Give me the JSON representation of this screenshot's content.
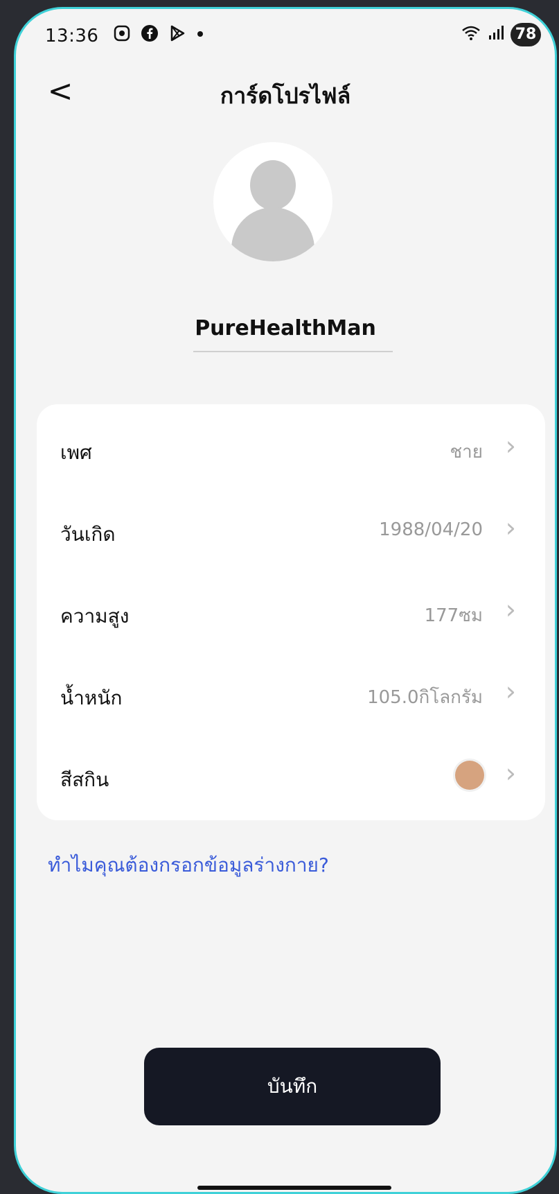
{
  "status": {
    "time": "13:36",
    "battery": "78",
    "icons_left": [
      "screen-record-icon",
      "facebook-icon",
      "play-store-icon",
      "dot-icon"
    ],
    "icons_right": [
      "wifi-icon",
      "signal-icon",
      "battery-icon"
    ]
  },
  "header": {
    "back": "<",
    "title": "การ์ดโปรไฟล์"
  },
  "profile": {
    "username": "PureHealthMan"
  },
  "fields": [
    {
      "label": "เพศ",
      "value": "ชาย"
    },
    {
      "label": "วันเกิด",
      "value": "1988/04/20"
    },
    {
      "label": "ความสูง",
      "value": "177ซม"
    },
    {
      "label": "น้ำหนัก",
      "value": "105.0กิโลกรัม"
    },
    {
      "label": "สีสกิน",
      "value": "",
      "swatch_color": "#d6a37f"
    }
  ],
  "why_link": "ทำไมคุณต้องกรอกข้อมูลร่างกาย?",
  "save_button": "บันทึก",
  "colors": {
    "accent_link": "#3a5bd9",
    "button_bg": "#151824",
    "frame_border": "#3fd1d8"
  }
}
